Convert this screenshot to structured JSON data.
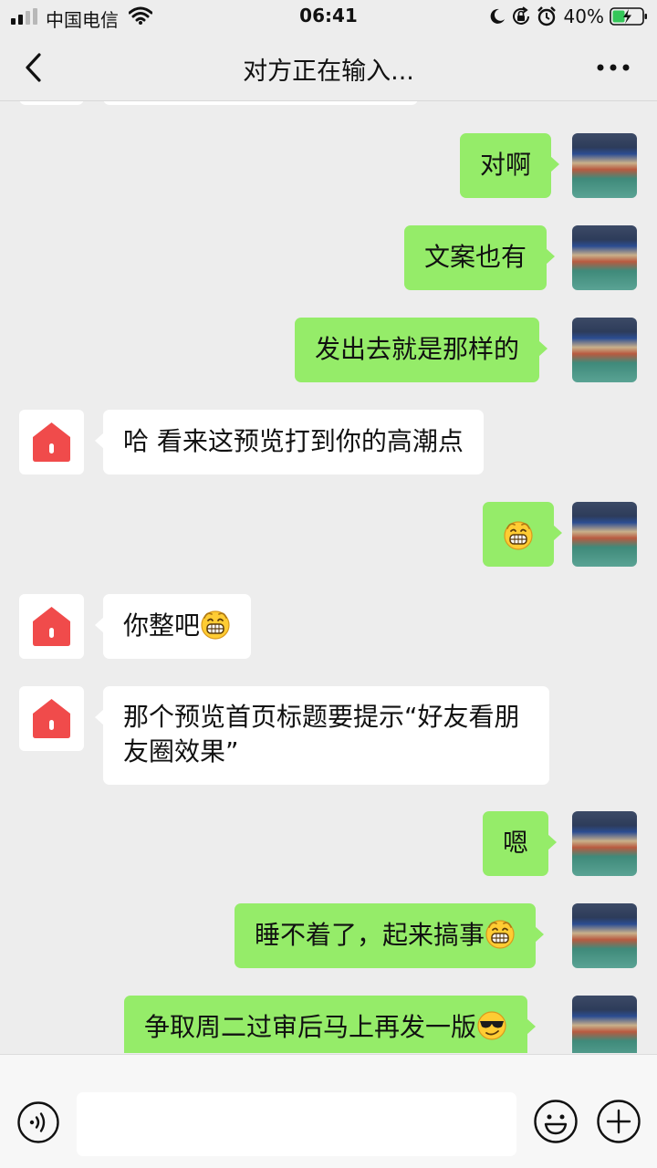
{
  "status_bar": {
    "carrier": "中国电信",
    "time": "06:41",
    "battery": "40%",
    "icons": [
      "signal-icon",
      "wifi-icon",
      "moon-icon",
      "orientation-lock-icon",
      "alarm-icon",
      "battery-charging-icon"
    ]
  },
  "nav": {
    "title": "对方正在输入...",
    "icons": [
      "back-arrow-icon",
      "more-icon"
    ]
  },
  "messages": [
    {
      "from": "me",
      "text": "对啊"
    },
    {
      "from": "me",
      "text": "文案也有"
    },
    {
      "from": "me",
      "text": "发出去就是那样的"
    },
    {
      "from": "them",
      "text": "哈 看来这预览打到你的高潮点"
    },
    {
      "from": "me",
      "text": "",
      "emoji": "grin-emoji"
    },
    {
      "from": "them",
      "text": "你整吧",
      "emoji": "grin-emoji"
    },
    {
      "from": "them",
      "text": "那个预览首页标题要提示“好友看朋友圈效果”"
    },
    {
      "from": "me",
      "text": "嗯"
    },
    {
      "from": "me",
      "text": "睡不着了，起来搞事",
      "emoji": "grin-emoji"
    },
    {
      "from": "me",
      "text": "争取周二过审后马上再发一版",
      "emoji": "cool-emoji"
    }
  ],
  "input_bar": {
    "placeholder": "",
    "icons": [
      "voice-icon",
      "emoji-icon",
      "plus-icon"
    ]
  },
  "colors": {
    "background": "#ededed",
    "my_bubble": "#95ec69",
    "their_bubble": "#ffffff",
    "their_avatar_red": "#f04b4b"
  }
}
